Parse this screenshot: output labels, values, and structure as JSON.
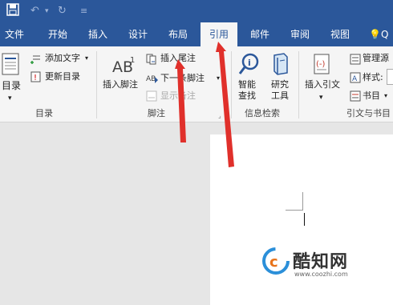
{
  "tabs": [
    "文件",
    "开始",
    "插入",
    "设计",
    "布局",
    "引用",
    "邮件",
    "审阅",
    "视图"
  ],
  "tell_me": "Q",
  "ribbon": {
    "toc": {
      "big_label": "目录",
      "add_text": "添加文字",
      "update": "更新目录",
      "group": "目录"
    },
    "footnotes": {
      "insert_footnote": "插入脚注",
      "insert_endnote": "插入尾注",
      "next_footnote": "下一条脚注",
      "show_notes": "显示备注",
      "group": "脚注"
    },
    "research": {
      "smart_lookup_1": "智能",
      "smart_lookup_2": "查找",
      "researcher_1": "研究",
      "researcher_2": "工具",
      "group": "信息检索"
    },
    "citations": {
      "insert_citation": "插入引文",
      "manage_sources": "管理源",
      "style": "样式:",
      "bibliography": "书目",
      "group": "引文与书目"
    }
  },
  "watermark": {
    "name": "酷知网",
    "url": "www.coozhi.com"
  },
  "colors": {
    "accent": "#2b579a",
    "arrow": "#e0302b"
  }
}
